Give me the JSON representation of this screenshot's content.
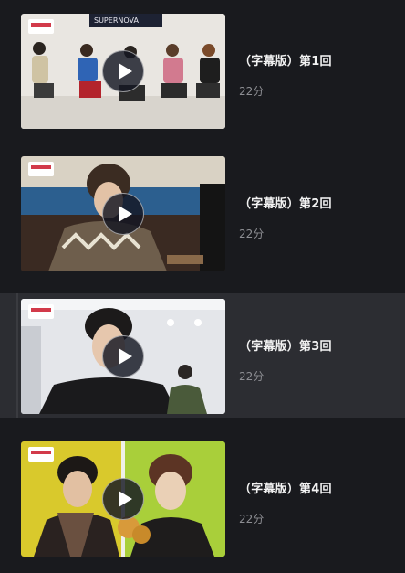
{
  "episodes": [
    {
      "title": "（字幕版）第1回",
      "duration": "22分"
    },
    {
      "title": "（字幕版）第2回",
      "duration": "22分"
    },
    {
      "title": "（字幕版）第3回",
      "duration": "22分"
    },
    {
      "title": "（字幕版）第4回",
      "duration": "22分"
    }
  ],
  "thumbnail_banner": "SUPERNOVA"
}
